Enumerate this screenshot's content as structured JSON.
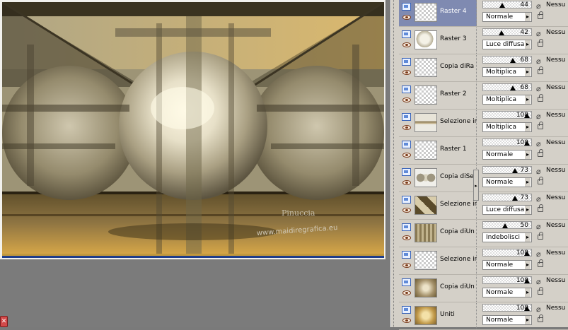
{
  "canvas": {
    "watermark_line1": "Pinuccia",
    "watermark_line2": "www.maidiregrafica.eu",
    "bottom_icon": "close-icon"
  },
  "layers": [
    {
      "name": "Raster 4",
      "opacity": 44,
      "blend": "Normale",
      "mask": "Nessu",
      "selected": true,
      "thumb": "empty"
    },
    {
      "name": "Raster 3",
      "opacity": 42,
      "blend": "Luce diffusa",
      "mask": "Nessu",
      "selected": false,
      "thumb": "sphere"
    },
    {
      "name": "Copia diRa",
      "opacity": 68,
      "blend": "Moltiplica",
      "mask": "Nessu",
      "selected": false,
      "thumb": "empty"
    },
    {
      "name": "Raster 2",
      "opacity": 68,
      "blend": "Moltiplica",
      "mask": "Nessu",
      "selected": false,
      "thumb": "empty"
    },
    {
      "name": "Selezione ir",
      "opacity": 100,
      "blend": "Moltiplica",
      "mask": "Nessu",
      "selected": false,
      "thumb": "band"
    },
    {
      "name": "Raster 1",
      "opacity": 100,
      "blend": "Normale",
      "mask": "Nessu",
      "selected": false,
      "thumb": "empty"
    },
    {
      "name": "Copia diSel",
      "opacity": 73,
      "blend": "Normale",
      "mask": "Nessu",
      "selected": false,
      "thumb": "spheres"
    },
    {
      "name": "Selezione ir",
      "opacity": 73,
      "blend": "Luce diffusa",
      "mask": "Nessu",
      "selected": false,
      "thumb": "diamond"
    },
    {
      "name": "Copia diUn",
      "opacity": 50,
      "blend": "Indebolisci",
      "mask": "Nessu",
      "selected": false,
      "thumb": "texture"
    },
    {
      "name": "Selezione ir",
      "opacity": 100,
      "blend": "Normale",
      "mask": "Nessu",
      "selected": false,
      "thumb": "empty"
    },
    {
      "name": "Copia diUn",
      "opacity": 100,
      "blend": "Normale",
      "mask": "Nessu",
      "selected": false,
      "thumb": "tan"
    },
    {
      "name": "Uniti",
      "opacity": 100,
      "blend": "Normale",
      "mask": "Nessu",
      "selected": false,
      "thumb": "gold"
    }
  ],
  "colors": {
    "selection": "#7f8ab1",
    "panel": "#d4d0c8",
    "canvas_bg": "#7b7b7b"
  }
}
